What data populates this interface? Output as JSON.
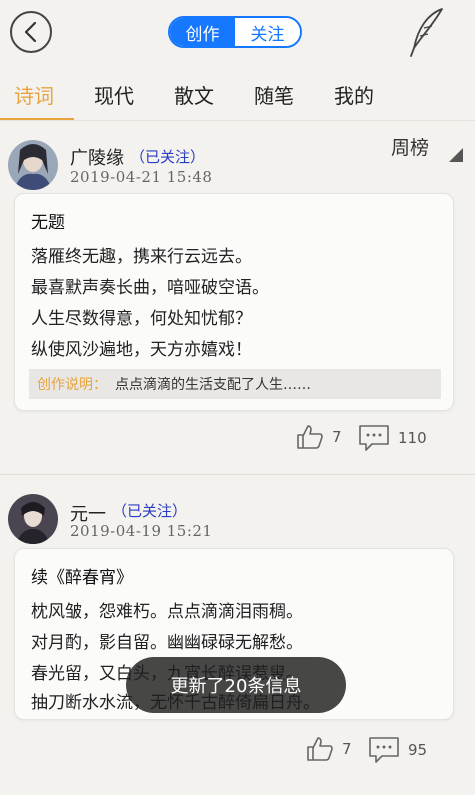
{
  "header": {
    "segments": [
      "创作",
      "关注"
    ],
    "active_segment": "创作",
    "accent": "#1677ff"
  },
  "tabs": [
    "诗词",
    "现代",
    "散文",
    "随笔",
    "我的"
  ],
  "active_tab": "诗词",
  "tab_accent": "#e8a33c",
  "rank_label": "周榜",
  "posts": [
    {
      "user": "广陵缘",
      "follow": "（已关注）",
      "time": "2019-04-21 15:48",
      "title": "无题",
      "lines": [
        "落雁终无趣，携来行云远去。",
        "最喜默声奏长曲，喑哑破空语。",
        "人生尽数得意，何处知忧郁？",
        "纵使风沙遍地，天方亦嬉戏！"
      ],
      "note_label": "创作说明：",
      "note_text": "点点滴滴的生活支配了人生……",
      "likes": "7",
      "comments": "110"
    },
    {
      "user": "元一",
      "follow": "（已关注）",
      "time": "2019-04-19 15:21",
      "title": "续《醉春宵》",
      "lines": [
        "枕风皱，怨难朽。点点滴滴泪雨稠。",
        "对月酌，影自留。幽幽碌碌无解愁。",
        "春光留，又白头，九宵长醉误惹叟。",
        "抽刀断水水流，无怀千古醉倚扁日舟。"
      ],
      "likes": "7",
      "comments": "95"
    }
  ],
  "toast": "更新了20条信息"
}
